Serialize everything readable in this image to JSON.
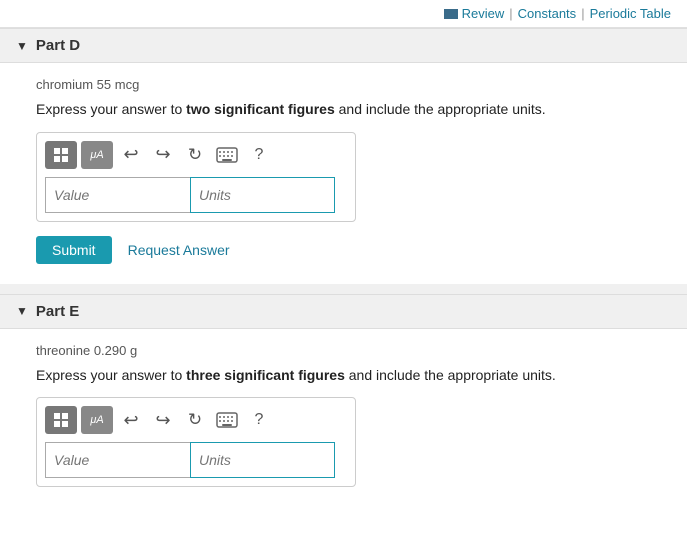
{
  "topbar": {
    "review_label": "Review",
    "constants_label": "Constants",
    "periodic_table_label": "Periodic Table",
    "sep": "|"
  },
  "part_d": {
    "header_label": "Part D",
    "substance": "chromium 55 mcg",
    "instruction": "Express your answer to two significant figures and include the appropriate units.",
    "instruction_bold": "two significant figures",
    "value_placeholder": "Value",
    "units_placeholder": "Units",
    "submit_label": "Submit",
    "request_label": "Request Answer"
  },
  "part_e": {
    "header_label": "Part E",
    "substance": "threonine 0.290 g",
    "instruction": "Express your answer to three significant figures and include the appropriate units.",
    "instruction_bold": "three significant figures",
    "value_placeholder": "Value",
    "units_placeholder": "Units"
  }
}
